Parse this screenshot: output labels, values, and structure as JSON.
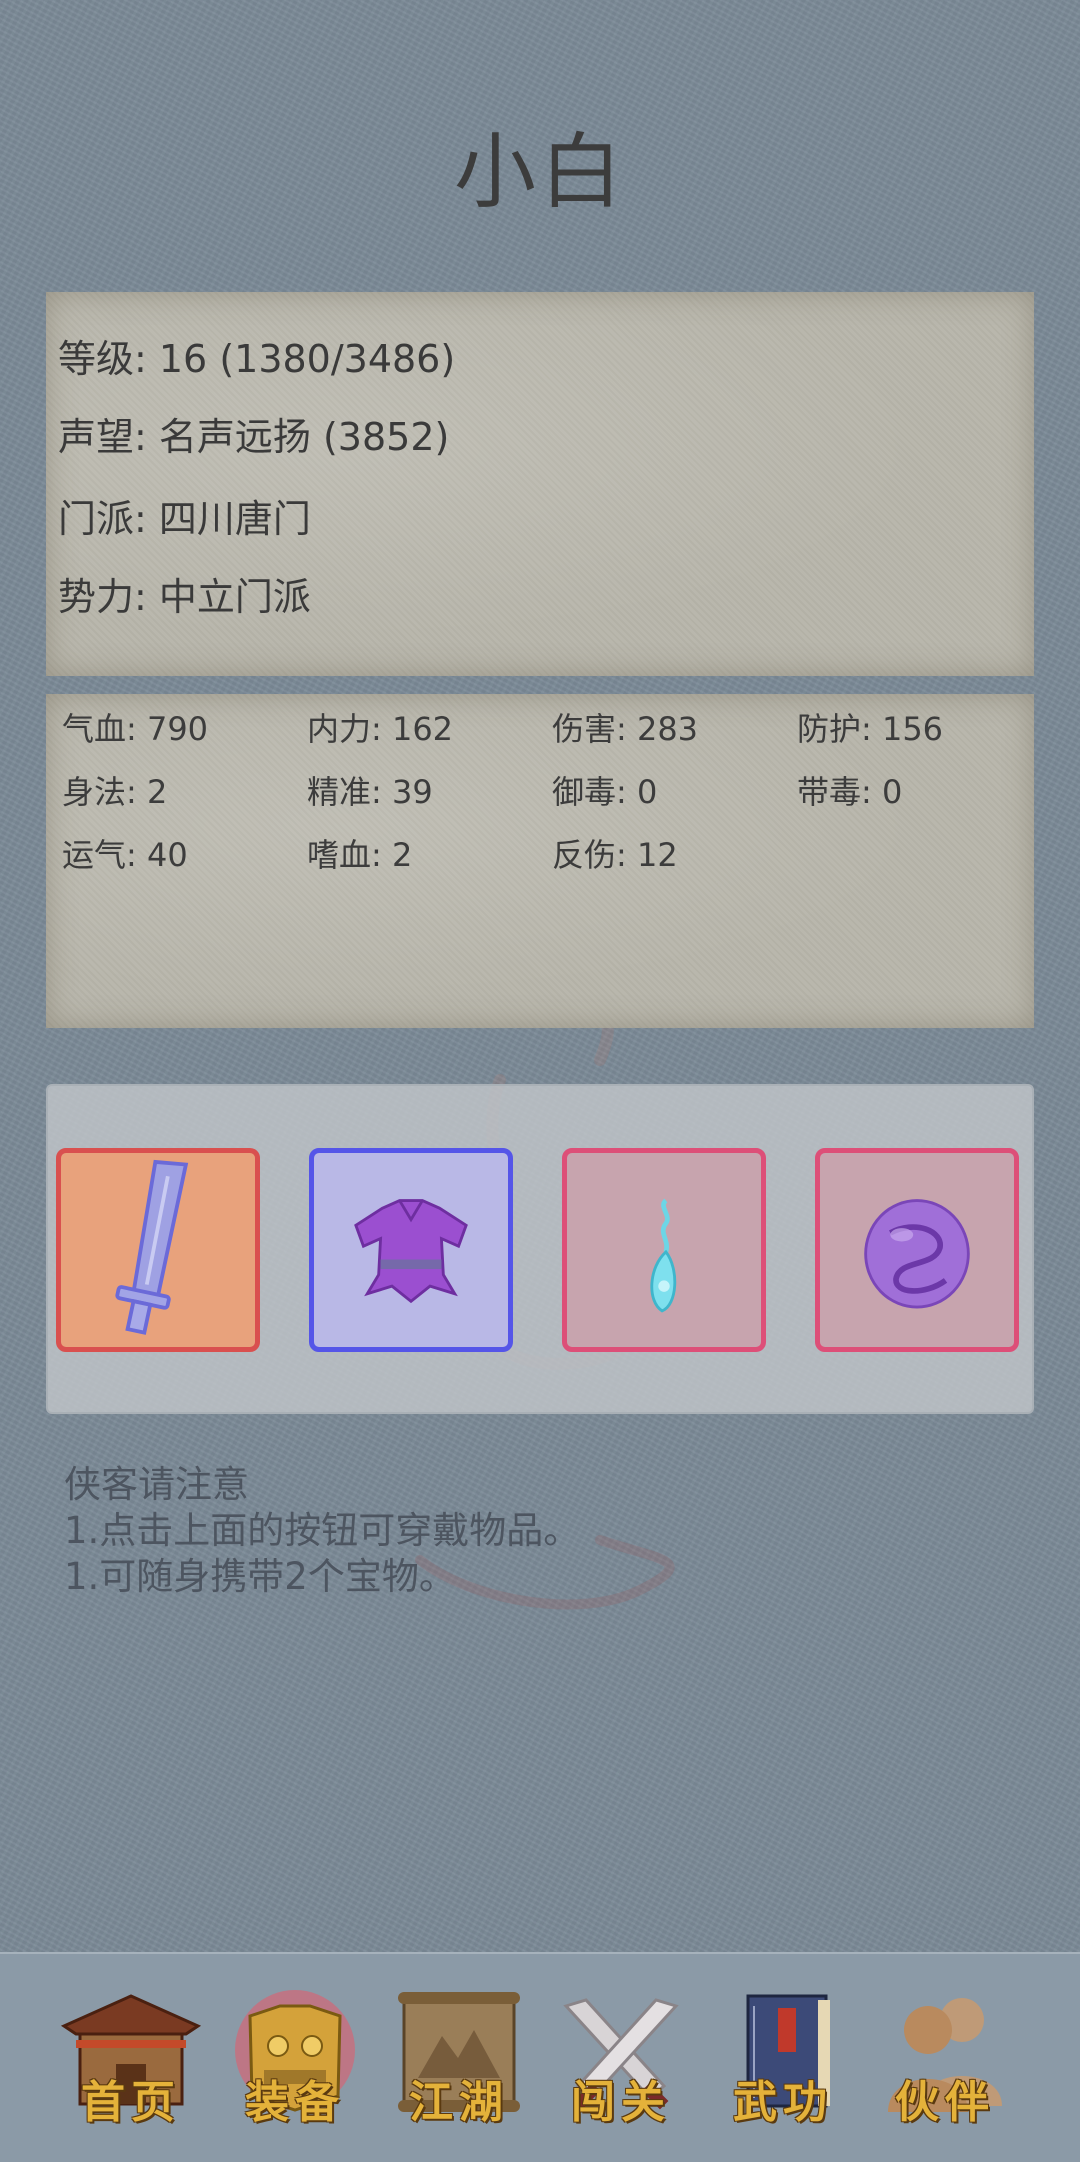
{
  "character": {
    "name": "小白"
  },
  "info": {
    "level": "等级: 16 (1380/3486)",
    "reputation": "声望: 名声远扬 (3852)",
    "sect": "门派: 四川唐门",
    "faction": "势力:  中立门派"
  },
  "stats": [
    {
      "label": "气血: 790"
    },
    {
      "label": "内力: 162"
    },
    {
      "label": "伤害: 283"
    },
    {
      "label": "防护: 156"
    },
    {
      "label": "身法: 2"
    },
    {
      "label": "精准: 39"
    },
    {
      "label": "御毒: 0"
    },
    {
      "label": "带毒: 0"
    },
    {
      "label": "运气: 40"
    },
    {
      "label": "嗜血: 2"
    },
    {
      "label": "反伤: 12"
    }
  ],
  "equipment": [
    {
      "slot": "weapon",
      "icon": "sword-icon",
      "border": "#d9504f",
      "bg": "#e8a27c"
    },
    {
      "slot": "armor",
      "icon": "robe-icon",
      "border": "#5555e8",
      "bg": "#b9b8e6"
    },
    {
      "slot": "treasure",
      "icon": "pendant-icon",
      "border": "#dd4f78",
      "bg": "#c7a4ae"
    },
    {
      "slot": "treasure",
      "icon": "orb-icon",
      "border": "#dd4f78",
      "bg": "#c7a4ae"
    }
  ],
  "notes": {
    "title": "侠客请注意",
    "line1": "1.点击上面的按钮可穿戴物品。",
    "line2": "1.可随身携带2个宝物。"
  },
  "nav": [
    {
      "label": "首页",
      "icon": "house-icon"
    },
    {
      "label": "装备",
      "icon": "armor-icon"
    },
    {
      "label": "江湖",
      "icon": "scroll-map-icon"
    },
    {
      "label": "闯关",
      "icon": "crossed-swords-icon"
    },
    {
      "label": "武功",
      "icon": "book-icon"
    },
    {
      "label": "伙伴",
      "icon": "companions-icon"
    }
  ]
}
